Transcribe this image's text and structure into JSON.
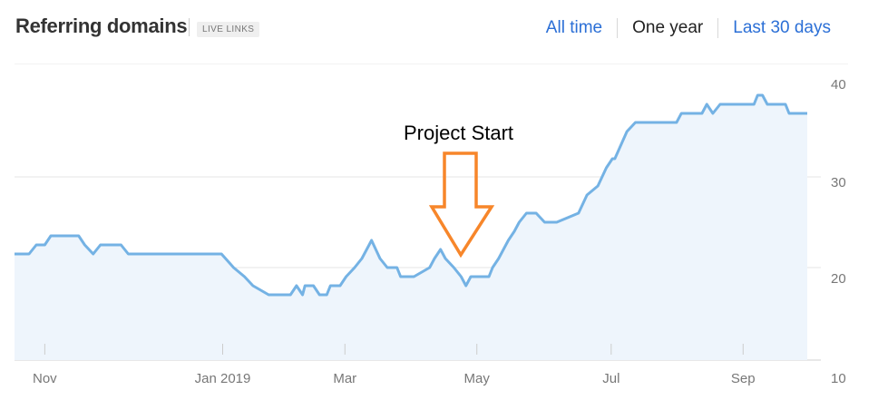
{
  "header": {
    "title": "Referring domains",
    "badge": "LIVE LINKS",
    "tabs": [
      {
        "label": "All time",
        "active": false
      },
      {
        "label": "One year",
        "active": true
      },
      {
        "label": "Last 30 days",
        "active": false
      }
    ]
  },
  "annotation": {
    "label": "Project Start",
    "color": "#f7862a"
  },
  "colors": {
    "line": "#74b2e4",
    "area": "#eef5fc",
    "grid": "#e6e6e6",
    "tab_link": "#2b6fd6"
  },
  "chart_data": {
    "type": "area",
    "title": "",
    "xlabel": "",
    "ylabel": "",
    "ylim": [
      10,
      40
    ],
    "grid": true,
    "y_axis_position": "right",
    "x_ticks": [
      {
        "label": "Nov",
        "x": 2.5
      },
      {
        "label": "Jan 2019",
        "x": 17.2
      },
      {
        "label": "Mar",
        "x": 27.3
      },
      {
        "label": "May",
        "x": 38.2
      },
      {
        "label": "Jul",
        "x": 49.3
      },
      {
        "label": "Sep",
        "x": 60.2
      }
    ],
    "y_ticks": [
      40,
      30,
      20,
      10
    ],
    "series": [
      {
        "x": [
          0.0,
          1.2,
          1.8,
          2.5,
          3.0,
          5.3,
          5.8,
          6.5,
          7.1,
          8.8,
          9.4,
          11.5,
          12.0,
          13.0,
          17.1,
          18.1,
          19.0,
          19.7,
          21.0,
          21.2,
          22.8,
          23.3,
          23.8,
          24.0,
          24.7,
          25.2,
          25.8,
          26.1,
          26.9,
          27.4,
          28.1,
          28.7,
          29.5,
          30.2,
          30.5,
          30.8,
          31.2,
          31.6,
          31.9,
          32.6,
          33.0,
          34.3,
          34.7,
          35.2,
          35.6,
          36.3,
          36.9,
          37.3,
          37.7,
          39.2,
          39.5,
          40.0,
          40.4,
          40.8,
          41.3,
          41.7,
          42.3,
          43.1,
          43.8,
          44.8,
          46.6,
          47.3,
          48.2,
          48.9,
          49.4,
          49.6,
          50.6,
          51.3,
          51.5,
          52.6,
          54.7,
          55.1,
          55.6,
          56.8,
          57.2,
          57.7,
          58.3,
          59.3,
          59.6,
          60.7,
          61.1,
          61.4,
          61.8,
          62.2,
          62.5,
          63.7,
          64.0,
          64.7,
          65.5
        ],
        "y": [
          21.5,
          21.5,
          22.5,
          22.5,
          23.5,
          23.5,
          22.5,
          21.5,
          22.5,
          22.5,
          21.5,
          21.5,
          21.5,
          21.5,
          21.5,
          20.0,
          19.0,
          18.0,
          17.0,
          17.0,
          17.0,
          18.0,
          17.0,
          18.0,
          18.0,
          17.0,
          17.0,
          18.0,
          18.0,
          19.0,
          20.0,
          21.0,
          23.0,
          21.0,
          20.5,
          20.0,
          20.0,
          20.0,
          19.0,
          19.0,
          19.0,
          20.0,
          21.0,
          22.0,
          21.0,
          20.0,
          19.0,
          18.0,
          19.0,
          19.0,
          20.0,
          21.0,
          22.0,
          23.0,
          24.0,
          25.0,
          26.0,
          26.0,
          25.0,
          25.0,
          26.0,
          28.0,
          29.0,
          31.0,
          32.0,
          32.0,
          35.0,
          36.0,
          36.0,
          36.0,
          36.0,
          37.0,
          37.0,
          37.0,
          38.0,
          37.0,
          38.0,
          38.0,
          38.0,
          38.0,
          38.0,
          39.0,
          39.0,
          38.0,
          38.0,
          38.0,
          37.0,
          37.0,
          37.0
        ]
      }
    ]
  }
}
